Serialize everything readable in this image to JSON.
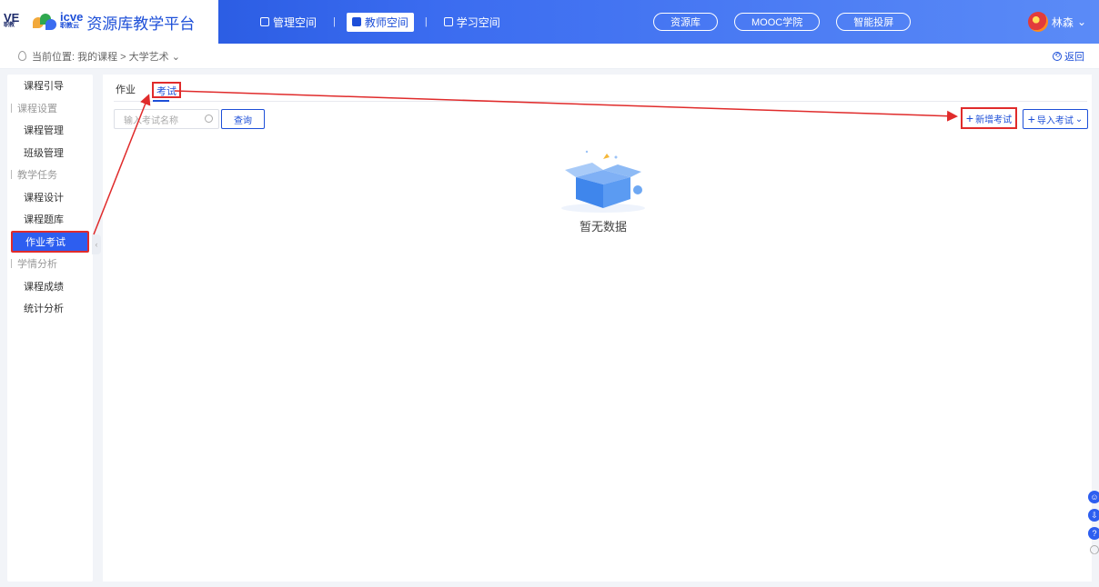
{
  "header": {
    "logo_left": "VE",
    "logo_left_sub": "职教",
    "logo_icve": "icve",
    "logo_icve_sub": "职教云",
    "platform_title": "资源库教学平台",
    "spaces": [
      {
        "label": "管理空间",
        "active": false
      },
      {
        "label": "教师空间",
        "active": true
      },
      {
        "label": "学习空间",
        "active": false
      }
    ],
    "separator": "|",
    "pills": [
      "资源库",
      "MOOC学院",
      "智能投屏"
    ],
    "user_name": "林森",
    "user_caret": "⌄"
  },
  "breadcrumb": {
    "text": "当前位置: 我的课程 > 大学艺术 ⌄",
    "back_label": "返回",
    "back_icon": "⟲"
  },
  "sidebar": {
    "items": [
      {
        "type": "item",
        "label": "课程引导"
      },
      {
        "type": "group",
        "label": "课程设置"
      },
      {
        "type": "item",
        "label": "课程管理"
      },
      {
        "type": "item",
        "label": "班级管理"
      },
      {
        "type": "group",
        "label": "教学任务"
      },
      {
        "type": "item",
        "label": "课程设计"
      },
      {
        "type": "item",
        "label": "课程题库"
      },
      {
        "type": "item",
        "label": "作业考试",
        "active": true
      },
      {
        "type": "group",
        "label": "学情分析"
      },
      {
        "type": "item",
        "label": "课程成绩"
      },
      {
        "type": "item",
        "label": "统计分析"
      }
    ],
    "collapse_icon": "‹"
  },
  "main": {
    "tabs": [
      {
        "label": "作业",
        "active": false
      },
      {
        "label": "考试",
        "active": true
      }
    ],
    "search_placeholder": "输入考试名称",
    "search_button": "查询",
    "add_button": "新增考试",
    "import_button": "导入考试",
    "import_caret": "⌄",
    "plus": "+",
    "empty_text": "暂无数据"
  },
  "float_tools": [
    "☺",
    "⇩",
    "?",
    "◦"
  ],
  "colors": {
    "primary": "#1d4fd8",
    "active_bg": "#2d5ef0",
    "highlight_red": "#e02b2b"
  }
}
